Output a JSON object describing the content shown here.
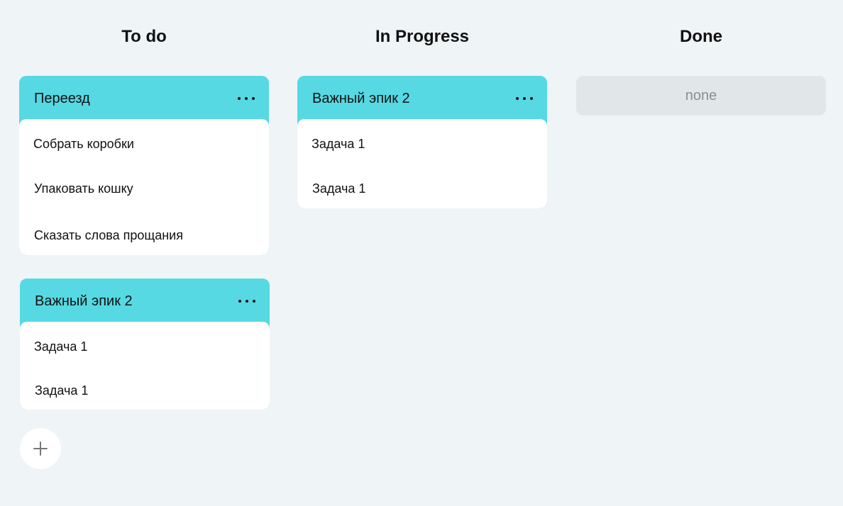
{
  "board": {
    "columns": [
      {
        "title": "To do",
        "epics": [
          {
            "title": "Переезд",
            "tasks": [
              "Собрать коробки",
              "Упаковать кошку",
              "Сказать слова прощания"
            ]
          },
          {
            "title": "Важный эпик 2",
            "tasks": [
              "Задача 1",
              "Задача 1"
            ]
          }
        ]
      },
      {
        "title": "In Progress",
        "epics": [
          {
            "title": "Важный эпик 2",
            "tasks": [
              "Задача 1",
              "Задача 1"
            ]
          }
        ]
      },
      {
        "title": "Done",
        "empty_label": "none",
        "epics": []
      }
    ]
  },
  "icons": {
    "epic_menu": "more-horizontal-icon",
    "add": "plus-icon"
  },
  "colors": {
    "background": "#eff4f6",
    "epic_header": "#56d9e3",
    "card": "#ffffff",
    "empty_card": "#e1e6e9",
    "empty_text": "#8a8f93"
  }
}
